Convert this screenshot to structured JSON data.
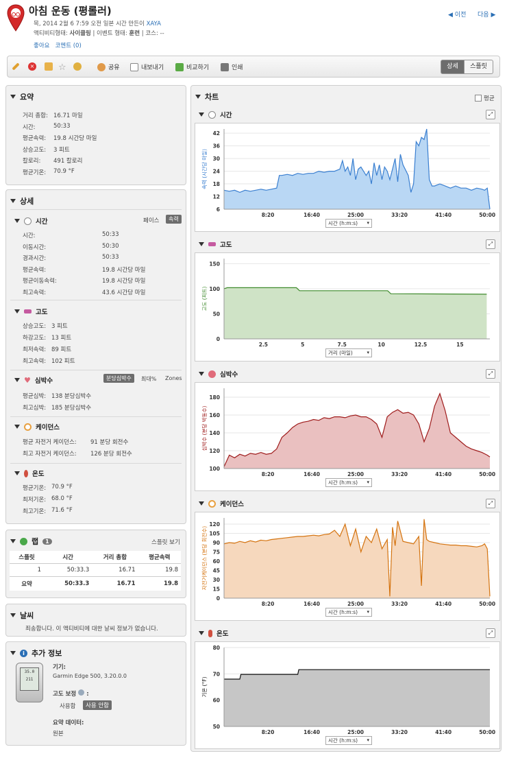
{
  "header": {
    "title": "아침 운동 (평롤러)",
    "line1_prefix": "목, 2014 2월 6 7:59 오전 일본 시간 만든이",
    "user": "XAYA",
    "activity_type_label": "액티비티형태:",
    "activity_type": "사이클링",
    "event_type_label": "| 이벤트 형태:",
    "event_type": "훈련",
    "course_label": "| 코스:",
    "course": "--",
    "like": "좋아요",
    "comments": "코멘트 (0)",
    "prev": "이전",
    "next": "다음"
  },
  "toolbar": {
    "share": "공유",
    "export": "내보내기",
    "compare": "비교하기",
    "print": "인쇄",
    "detail": "상세",
    "split": "스플릿"
  },
  "summary": {
    "title": "요약",
    "rows": [
      {
        "label": "거리 총합:",
        "value": "16.71 마일"
      },
      {
        "label": "시간:",
        "value": "50:33"
      },
      {
        "label": "평균속력:",
        "value": "19.8 시간당 마일"
      },
      {
        "label": "상승고도:",
        "value": "3 피트"
      },
      {
        "label": "칼로리:",
        "value": "491 칼로리"
      },
      {
        "label": "평균기온:",
        "value": "70.9 °F"
      }
    ]
  },
  "details": {
    "title": "상세",
    "time": {
      "title": "시간",
      "pace": "페이스",
      "speed": "속력",
      "rows": [
        {
          "label": "시간:",
          "value": "50:33"
        },
        {
          "label": "이동시간:",
          "value": "50:30"
        },
        {
          "label": "경과시간:",
          "value": "50:33"
        },
        {
          "label": "평균속력:",
          "value": "19.8 시간당 마일"
        },
        {
          "label": "평균이동속력:",
          "value": "19.8 시간당 마일"
        },
        {
          "label": "최고속력:",
          "value": "43.6 시간당 마일"
        }
      ]
    },
    "elevation": {
      "title": "고도",
      "rows": [
        {
          "label": "상승고도:",
          "value": "3 피트"
        },
        {
          "label": "하강고도:",
          "value": "13 피트"
        },
        {
          "label": "최저속력:",
          "value": "89 피트"
        },
        {
          "label": "최고속력:",
          "value": "102 피트"
        }
      ]
    },
    "heart": {
      "title": "심박수",
      "bpm": "분당심박수",
      "max": "최대%",
      "zones": "Zones",
      "rows": [
        {
          "label": "평균심박:",
          "value": "138 분당심박수"
        },
        {
          "label": "최고심박:",
          "value": "185 분당심박수"
        }
      ]
    },
    "cadence": {
      "title": "케이던스",
      "rows": [
        {
          "label": "평균 자전거 케이던스:",
          "value": "91 분당 회전수"
        },
        {
          "label": "최고 자전거 케이던스:",
          "value": "126 분당 회전수"
        }
      ]
    },
    "temp": {
      "title": "온도",
      "rows": [
        {
          "label": "평균기온:",
          "value": "70.9 °F"
        },
        {
          "label": "최저기온:",
          "value": "68.0 °F"
        },
        {
          "label": "최고기온:",
          "value": "71.6 °F"
        }
      ]
    }
  },
  "laps": {
    "title": "랩",
    "count": "1",
    "split_view": "스플릿 보기",
    "headers": [
      "스플릿",
      "시간",
      "거리 총합",
      "평균속력"
    ],
    "rows": [
      [
        "1",
        "50:33.3",
        "16.71",
        "19.8"
      ]
    ],
    "total": [
      "요약",
      "50:33.3",
      "16.71",
      "19.8"
    ]
  },
  "weather": {
    "title": "날씨",
    "text": "죄송합니다. 이 액티비티에 대한 날씨 정보가 없습니다."
  },
  "extra": {
    "title": "추가 정보",
    "device_label": "기기:",
    "device": "Garmin Edge 500, 3.20.0.0",
    "elev_corr_label": "고도 보정",
    "elev_corr_colon": ":",
    "use": "사용함",
    "not_use": "사용 안함",
    "summary_data_label": "요약 데이터:",
    "summary_data": "원본",
    "screen_top": "35.0",
    "screen_bot": "211"
  },
  "charts_panel": {
    "title": "차트",
    "avg": "평균"
  },
  "chart_data": [
    {
      "name": "시간",
      "type": "area",
      "color": "#3a7fd0",
      "fill": "#b9d7f4",
      "ylabel": "속력 (시간당 마일)",
      "xlabel": "시간 (h:m:s)",
      "ylim": [
        6,
        44
      ],
      "yticks": [
        6,
        12,
        18,
        24,
        30,
        36,
        42
      ],
      "xlim": [
        0,
        50.5
      ],
      "xticks": [
        8.333,
        16.667,
        25,
        33.333,
        41.667,
        50
      ],
      "xticklabels": [
        "8:20",
        "16:40",
        "25:00",
        "33:20",
        "41:40",
        "50:00"
      ],
      "x": [
        0,
        1,
        2,
        3,
        4,
        5,
        6,
        7,
        8,
        9,
        10,
        10.5,
        11,
        12,
        13,
        14,
        15,
        16,
        17,
        18,
        19,
        20,
        21,
        22,
        22.5,
        23,
        23.5,
        24,
        24.5,
        25,
        25.5,
        26,
        27,
        27.5,
        28,
        28.5,
        29,
        29.5,
        30,
        30.5,
        31,
        31.5,
        32,
        32.5,
        33,
        33.5,
        34,
        35,
        35.5,
        36,
        36.5,
        37,
        37.5,
        38,
        38.5,
        39,
        39.5,
        40,
        41,
        42,
        43,
        44,
        45,
        46,
        47,
        48,
        49,
        49.5,
        50,
        50.5
      ],
      "values": [
        15,
        14.5,
        15,
        14,
        15,
        14.5,
        15,
        15.5,
        15,
        15.5,
        16,
        22,
        22,
        22.5,
        22,
        23,
        22.5,
        23,
        23,
        24,
        23.5,
        24,
        24,
        25,
        29,
        24,
        26,
        22,
        30,
        20,
        25,
        26,
        22,
        24,
        18,
        28,
        22,
        27,
        20,
        26,
        24,
        20,
        25,
        30,
        19,
        32,
        27,
        22,
        14,
        18,
        38,
        36,
        40,
        39,
        44,
        20,
        17,
        17,
        18,
        17,
        16,
        17,
        16,
        16,
        15,
        16,
        15.5,
        15,
        16,
        6
      ]
    },
    {
      "name": "고도",
      "type": "area",
      "color": "#3f8a2c",
      "fill": "#cfe3c6",
      "ylabel": "고도 (피트)",
      "xlabel": "거리 (마일)",
      "ylim": [
        0,
        160
      ],
      "yticks": [
        0,
        50,
        100,
        150
      ],
      "xlim": [
        0,
        16.9
      ],
      "xticks": [
        2.5,
        5,
        7.5,
        10,
        12.5,
        15
      ],
      "xticklabels": [
        "2.5",
        "5",
        "7.5",
        "10",
        "12.5",
        "15"
      ],
      "x": [
        0,
        0.2,
        4.6,
        4.8,
        10.4,
        10.6,
        16.7
      ],
      "values": [
        100,
        102,
        102,
        96,
        96,
        90,
        89
      ]
    },
    {
      "name": "심박수",
      "type": "area",
      "color": "#9e1b1b",
      "fill": "#eac0c0",
      "ylabel": "심박수 (분당 박동수)",
      "xlabel": "시간 (h:m:s)",
      "ylim": [
        100,
        190
      ],
      "yticks": [
        100,
        120,
        140,
        160,
        180
      ],
      "xlim": [
        0,
        50.5
      ],
      "xticks": [
        8.333,
        16.667,
        25,
        33.333,
        41.667,
        50
      ],
      "xticklabels": [
        "8:20",
        "16:40",
        "25:00",
        "33:20",
        "41:40",
        "50:00"
      ],
      "x": [
        0,
        1,
        2,
        3,
        4,
        5,
        6,
        7,
        8,
        9,
        10,
        11,
        12,
        13,
        14,
        15,
        16,
        17,
        18,
        19,
        20,
        21,
        22,
        23,
        24,
        25,
        26,
        27,
        28,
        29,
        30,
        31,
        32,
        33,
        34,
        35,
        36,
        37,
        38,
        39,
        40,
        41,
        42,
        43,
        44,
        45,
        46,
        47,
        48,
        49,
        50,
        50.5
      ],
      "values": [
        102,
        115,
        112,
        116,
        114,
        117,
        116,
        118,
        116,
        117,
        122,
        135,
        140,
        146,
        150,
        152,
        153,
        155,
        154,
        157,
        156,
        158,
        158,
        157,
        159,
        160,
        158,
        158,
        155,
        150,
        135,
        158,
        163,
        166,
        162,
        163,
        160,
        150,
        130,
        145,
        170,
        184,
        165,
        140,
        135,
        130,
        125,
        122,
        120,
        118,
        115,
        113
      ]
    },
    {
      "name": "케이던스",
      "type": "area",
      "color": "#d4730f",
      "fill": "#f6d8bd",
      "ylabel": "자전거케이던스 (분당 회전수)",
      "xlabel": "시간 (h:m:s)",
      "ylim": [
        0,
        130
      ],
      "yticks": [
        0,
        15,
        30,
        45,
        60,
        75,
        90,
        105,
        120
      ],
      "xlim": [
        0,
        50.5
      ],
      "xticks": [
        8.333,
        16.667,
        25,
        33.333,
        41.667,
        50
      ],
      "xticklabels": [
        "8:20",
        "16:40",
        "25:00",
        "33:20",
        "41:40",
        "50:00"
      ],
      "x": [
        0,
        1,
        2,
        3,
        4,
        5,
        6,
        7,
        8,
        9,
        10,
        11,
        12,
        13,
        14,
        15,
        16,
        17,
        18,
        19,
        20,
        21,
        22,
        23,
        24,
        25,
        26,
        27,
        28,
        29,
        30,
        31,
        31.5,
        32,
        32.5,
        33,
        34,
        35,
        36,
        37,
        37.5,
        38,
        38.5,
        39,
        40,
        41,
        42,
        43,
        44,
        45,
        46,
        47,
        48,
        49,
        49.5,
        50,
        50.5
      ],
      "values": [
        88,
        90,
        89,
        92,
        90,
        93,
        91,
        94,
        93,
        95,
        96,
        97,
        98,
        99,
        100,
        100,
        101,
        102,
        101,
        103,
        104,
        110,
        100,
        120,
        85,
        112,
        75,
        100,
        90,
        112,
        80,
        95,
        3,
        115,
        85,
        125,
        92,
        90,
        88,
        100,
        20,
        128,
        95,
        92,
        90,
        88,
        87,
        86,
        86,
        85,
        85,
        84,
        83,
        85,
        88,
        80,
        3
      ]
    },
    {
      "name": "온도",
      "type": "area",
      "color": "#111111",
      "fill": "#c6c6c6",
      "ylabel": "기온 (°F)",
      "xlabel": "시간 (h:m:s)",
      "ylim": [
        50,
        80
      ],
      "yticks": [
        50,
        60,
        70,
        80
      ],
      "xlim": [
        0,
        50.5
      ],
      "xticks": [
        8.333,
        16.667,
        25,
        33.333,
        41.667,
        50
      ],
      "xticklabels": [
        "8:20",
        "16:40",
        "25:00",
        "33:20",
        "41:40",
        "50:00"
      ],
      "x": [
        0,
        3,
        3.2,
        14,
        14.2,
        50.5
      ],
      "values": [
        68,
        68,
        69.8,
        69.8,
        71.6,
        71.6
      ]
    }
  ]
}
